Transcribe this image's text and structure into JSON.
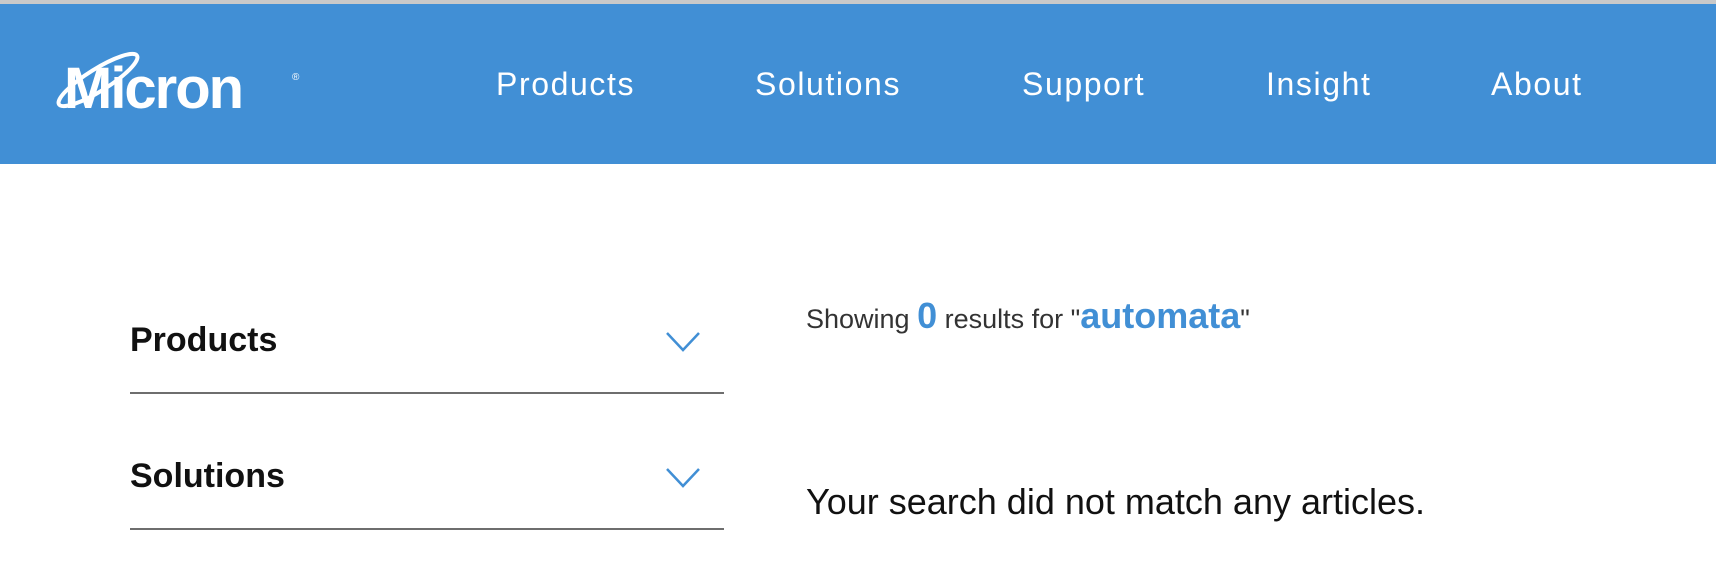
{
  "brand": {
    "logo_text": "Micron",
    "header_color": "#418fd5",
    "accent_color": "#418fd5"
  },
  "nav": {
    "items": [
      {
        "label": "Products"
      },
      {
        "label": "Solutions"
      },
      {
        "label": "Support"
      },
      {
        "label": "Insight"
      },
      {
        "label": "About"
      }
    ]
  },
  "filters": {
    "items": [
      {
        "label": "Products",
        "icon": "chevron-down-icon"
      },
      {
        "label": "Solutions",
        "icon": "chevron-down-icon"
      }
    ]
  },
  "results": {
    "prefix": "Showing ",
    "count": "0",
    "middle": " results for \"",
    "query": "automata",
    "suffix": "\"",
    "empty_message": "Your search did not match any articles."
  }
}
